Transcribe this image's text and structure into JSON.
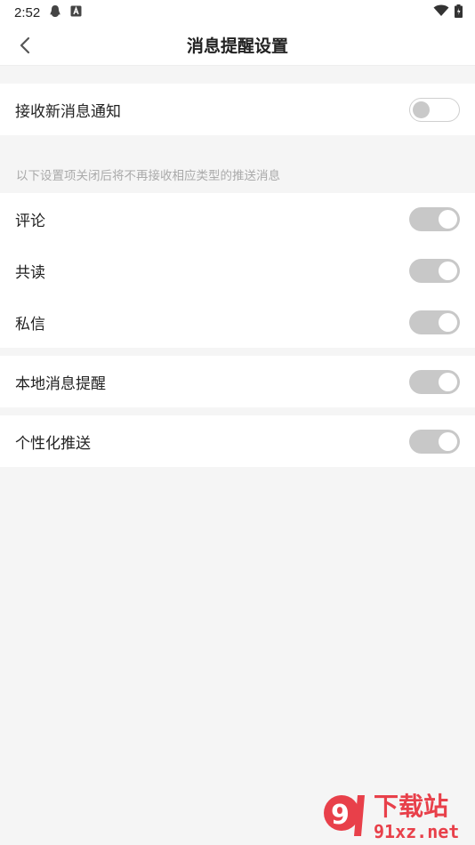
{
  "status_bar": {
    "time": "2:52"
  },
  "nav": {
    "title": "消息提醒设置"
  },
  "settings": {
    "receive_notifications": {
      "label": "接收新消息通知",
      "enabled": false
    },
    "hint": "以下设置项关闭后将不再接收相应类型的推送消息",
    "comment": {
      "label": "评论",
      "enabled": true
    },
    "co_reading": {
      "label": "共读",
      "enabled": true
    },
    "private_message": {
      "label": "私信",
      "enabled": true
    },
    "local_reminder": {
      "label": "本地消息提醒",
      "enabled": true
    },
    "personalized_push": {
      "label": "个性化推送",
      "enabled": true
    }
  },
  "watermark": {
    "brand": "下载站",
    "url": "91xz.net"
  }
}
